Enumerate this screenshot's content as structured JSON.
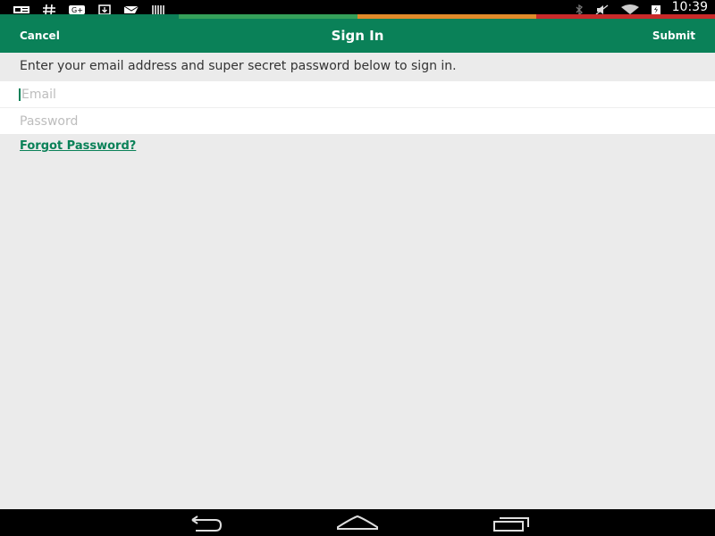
{
  "status_bar": {
    "time": "10:39",
    "left_icons": [
      "notification-card-icon",
      "hashtag-icon",
      "google-plus-icon",
      "download-icon",
      "mail-icon",
      "barcode-icon"
    ],
    "right_icons": [
      "bluetooth-icon",
      "muted-icon",
      "wifi-icon",
      "battery-charging-icon"
    ]
  },
  "progress_stripe_colors": [
    "#0c7f57",
    "#35a05a",
    "#e08a2a",
    "#c92a2a"
  ],
  "header": {
    "cancel_label": "Cancel",
    "title": "Sign In",
    "submit_label": "Submit",
    "background": "#0a8158"
  },
  "instructions": "Enter your email address and super secret password below to sign in.",
  "form": {
    "email": {
      "value": "",
      "placeholder": "Email"
    },
    "password": {
      "value": "",
      "placeholder": "Password"
    },
    "forgot_label": "Forgot Password?"
  },
  "nav_bar": {
    "buttons": [
      "back-icon",
      "home-icon",
      "recents-icon"
    ]
  }
}
